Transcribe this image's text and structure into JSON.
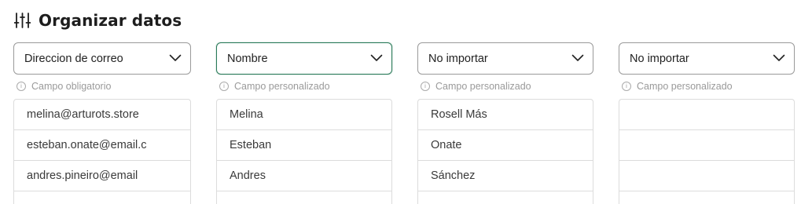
{
  "header": {
    "title": "Organizar datos",
    "icon": "sliders-icon"
  },
  "columns": [
    {
      "select_value": "Direccion de correo",
      "hint": "Campo obligatorio",
      "active": false,
      "rows": [
        "melina@arturots.store",
        "esteban.onate@email.c",
        "andres.pineiro@email",
        ""
      ]
    },
    {
      "select_value": "Nombre",
      "hint": "Campo personalizado",
      "active": true,
      "rows": [
        "Melina",
        "Esteban",
        "Andres",
        ""
      ]
    },
    {
      "select_value": "No importar",
      "hint": "Campo personalizado",
      "active": false,
      "rows": [
        "Rosell Más",
        "Onate",
        "Sánchez",
        ""
      ]
    },
    {
      "select_value": "No importar",
      "hint": "Campo personalizado",
      "active": false,
      "rows": [
        "",
        "",
        "",
        ""
      ]
    }
  ],
  "colors": {
    "active_border": "#2a7a59",
    "border": "#9a9a9a",
    "hint_text": "#9a9a9a"
  }
}
